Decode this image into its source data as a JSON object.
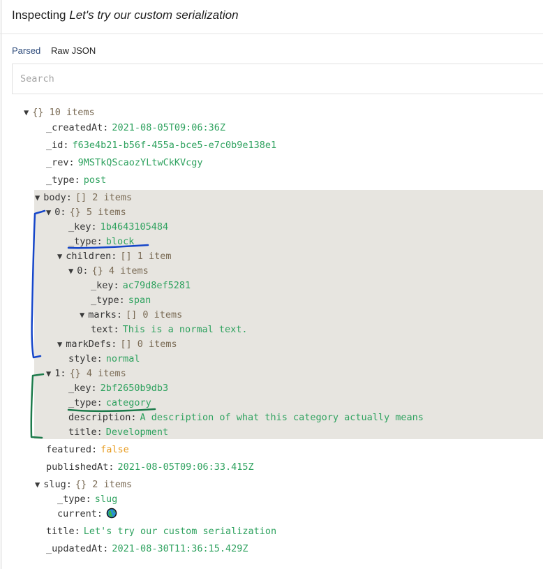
{
  "header": {
    "prefix": "Inspecting",
    "title": "Let's try our custom serialization"
  },
  "tabs": {
    "parsed": "Parsed",
    "raw": "Raw JSON"
  },
  "search": {
    "placeholder": "Search",
    "value": ""
  },
  "tree": {
    "rows": [
      {
        "toggle": "▼",
        "key": "",
        "colon": "",
        "meta": "{} 10 items",
        "value": "",
        "vtype": ""
      },
      {
        "toggle": "",
        "key": "_createdAt",
        "colon": ":",
        "meta": "",
        "value": "2021-08-05T09:06:36Z",
        "vtype": "str"
      },
      {
        "toggle": "",
        "key": "_id",
        "colon": ":",
        "meta": "",
        "value": "f63e4b21-b56f-455a-bce5-e7c0b9e138e1",
        "vtype": "str"
      },
      {
        "toggle": "",
        "key": "_rev",
        "colon": ":",
        "meta": "",
        "value": "9MSTkQScaozYLtwCkKVcgy",
        "vtype": "str"
      },
      {
        "toggle": "",
        "key": "_type",
        "colon": ":",
        "meta": "",
        "value": "post",
        "vtype": "str"
      },
      {
        "toggle": "▼",
        "key": "body",
        "colon": ":",
        "meta": "[] 2 items",
        "value": "",
        "vtype": ""
      },
      {
        "toggle": "▼",
        "key": "0",
        "colon": ":",
        "meta": "{} 5 items",
        "value": "",
        "vtype": ""
      },
      {
        "toggle": "",
        "key": "_key",
        "colon": ":",
        "meta": "",
        "value": "1b4643105484",
        "vtype": "str"
      },
      {
        "toggle": "",
        "key": "_type",
        "colon": ":",
        "meta": "",
        "value": "block",
        "vtype": "str"
      },
      {
        "toggle": "▼",
        "key": "children",
        "colon": ":",
        "meta": "[] 1 item",
        "value": "",
        "vtype": ""
      },
      {
        "toggle": "▼",
        "key": "0",
        "colon": ":",
        "meta": "{} 4 items",
        "value": "",
        "vtype": ""
      },
      {
        "toggle": "",
        "key": "_key",
        "colon": ":",
        "meta": "",
        "value": "ac79d8ef5281",
        "vtype": "str"
      },
      {
        "toggle": "",
        "key": "_type",
        "colon": ":",
        "meta": "",
        "value": "span",
        "vtype": "str"
      },
      {
        "toggle": "▼",
        "key": "marks",
        "colon": ":",
        "meta": "[] 0 items",
        "value": "",
        "vtype": ""
      },
      {
        "toggle": "",
        "key": "text",
        "colon": ":",
        "meta": "",
        "value": "This is a normal text.",
        "vtype": "str"
      },
      {
        "toggle": "▼",
        "key": "markDefs",
        "colon": ":",
        "meta": "[] 0 items",
        "value": "",
        "vtype": ""
      },
      {
        "toggle": "",
        "key": "style",
        "colon": ":",
        "meta": "",
        "value": "normal",
        "vtype": "str"
      },
      {
        "toggle": "▼",
        "key": "1",
        "colon": ":",
        "meta": "{} 4 items",
        "value": "",
        "vtype": ""
      },
      {
        "toggle": "",
        "key": "_key",
        "colon": ":",
        "meta": "",
        "value": "2bf2650b9db3",
        "vtype": "str"
      },
      {
        "toggle": "",
        "key": "_type",
        "colon": ":",
        "meta": "",
        "value": "category",
        "vtype": "str"
      },
      {
        "toggle": "",
        "key": "description",
        "colon": ":",
        "meta": "",
        "value": "A description of what this category actually means",
        "vtype": "str"
      },
      {
        "toggle": "",
        "key": "title",
        "colon": ":",
        "meta": "",
        "value": "Development",
        "vtype": "str"
      },
      {
        "toggle": "",
        "key": "featured",
        "colon": ":",
        "meta": "",
        "value": "false",
        "vtype": "bool"
      },
      {
        "toggle": "",
        "key": "publishedAt",
        "colon": ":",
        "meta": "",
        "value": "2021-08-05T09:06:33.415Z",
        "vtype": "str"
      },
      {
        "toggle": "▼",
        "key": "slug",
        "colon": ":",
        "meta": "{} 2 items",
        "value": "",
        "vtype": ""
      },
      {
        "toggle": "",
        "key": "_type",
        "colon": ":",
        "meta": "",
        "value": "slug",
        "vtype": "str"
      },
      {
        "toggle": "",
        "key": "current",
        "colon": ":",
        "meta": "",
        "value": "",
        "vtype": "globe-icon"
      },
      {
        "toggle": "",
        "key": "title",
        "colon": ":",
        "meta": "",
        "value": "Let's try our custom serialization",
        "vtype": "str"
      },
      {
        "toggle": "",
        "key": "_updatedAt",
        "colon": ":",
        "meta": "",
        "value": "2021-08-30T11:36:15.429Z",
        "vtype": "str"
      }
    ]
  },
  "colors": {
    "string": "#2fa25f",
    "boolean": "#e79a1c",
    "meta": "#7a6b55",
    "highlight": "#e7e5e0",
    "annotation_blue": "#1646c9",
    "annotation_green": "#1c7a4a"
  }
}
